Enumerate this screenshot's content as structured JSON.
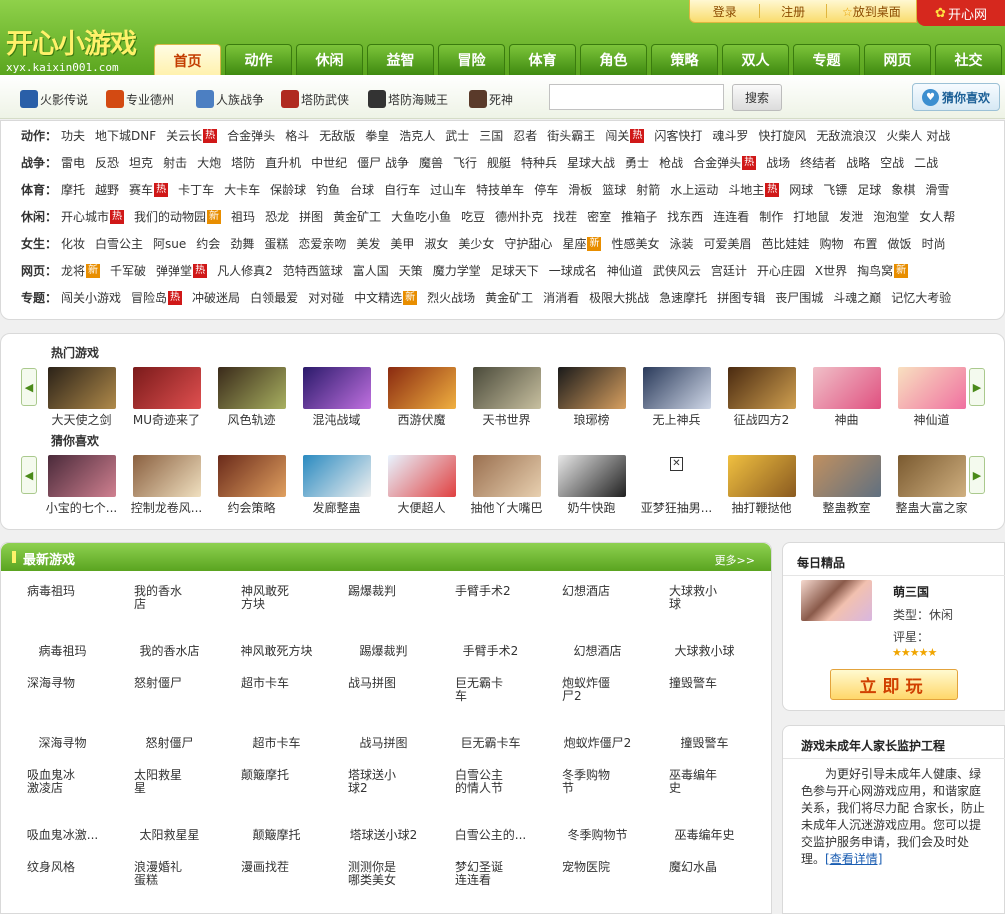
{
  "logo": {
    "title": "开心小游戏",
    "url": "xyx.kaixin001.com"
  },
  "toplinks": {
    "login": "登录",
    "register": "注册",
    "desktop": "放到桌面",
    "brand": "开心网"
  },
  "nav": [
    "首页",
    "动作",
    "休闲",
    "益智",
    "冒险",
    "体育",
    "角色",
    "策略",
    "双人",
    "专题",
    "网页",
    "社交"
  ],
  "quick": [
    {
      "label": "火影传说",
      "color": "#2a5fa8"
    },
    {
      "label": "专业德州",
      "color": "#d34a12"
    },
    {
      "label": "人族战争",
      "color": "#4c7fc2"
    },
    {
      "label": "塔防武侠",
      "color": "#b02a20"
    },
    {
      "label": "塔防海贼王",
      "color": "#333333"
    },
    {
      "label": "死神",
      "color": "#5a3a2a"
    }
  ],
  "search": {
    "button": "搜索",
    "placeholder": ""
  },
  "guess_button": "猜你喜欢",
  "categories": [
    {
      "label": "动作：",
      "items": [
        {
          "t": "功夫"
        },
        {
          "t": "地下城DNF"
        },
        {
          "t": "关云长",
          "tag": "热"
        },
        {
          "t": "合金弹头"
        },
        {
          "t": "格斗"
        },
        {
          "t": "无敌版"
        },
        {
          "t": "拳皇"
        },
        {
          "t": "浩克人"
        },
        {
          "t": "武士"
        },
        {
          "t": "三国"
        },
        {
          "t": "忍者"
        },
        {
          "t": "街头霸王"
        },
        {
          "t": "闯关",
          "tag": "热"
        },
        {
          "t": "闪客快打"
        },
        {
          "t": "魂斗罗"
        },
        {
          "t": "快打旋风"
        },
        {
          "t": "无敌流浪汉"
        },
        {
          "t": "火柴人 对战"
        }
      ]
    },
    {
      "label": "战争：",
      "items": [
        {
          "t": "雷电"
        },
        {
          "t": "反恐"
        },
        {
          "t": "坦克"
        },
        {
          "t": "射击"
        },
        {
          "t": "大炮"
        },
        {
          "t": "塔防"
        },
        {
          "t": "直升机"
        },
        {
          "t": "中世纪"
        },
        {
          "t": "僵尸 战争"
        },
        {
          "t": "魔兽"
        },
        {
          "t": "飞行"
        },
        {
          "t": "舰艇"
        },
        {
          "t": "特种兵"
        },
        {
          "t": "星球大战"
        },
        {
          "t": "勇士"
        },
        {
          "t": "枪战"
        },
        {
          "t": "合金弹头",
          "tag": "热"
        },
        {
          "t": "战场"
        },
        {
          "t": "终结者"
        },
        {
          "t": "战略"
        },
        {
          "t": "空战"
        },
        {
          "t": "二战"
        }
      ]
    },
    {
      "label": "体育：",
      "items": [
        {
          "t": "摩托"
        },
        {
          "t": "越野"
        },
        {
          "t": "赛车",
          "tag": "热"
        },
        {
          "t": "卡丁车"
        },
        {
          "t": "大卡车"
        },
        {
          "t": "保龄球"
        },
        {
          "t": "钓鱼"
        },
        {
          "t": "台球"
        },
        {
          "t": "自行车"
        },
        {
          "t": "过山车"
        },
        {
          "t": "特技单车"
        },
        {
          "t": "停车"
        },
        {
          "t": "滑板"
        },
        {
          "t": "篮球"
        },
        {
          "t": "射箭"
        },
        {
          "t": "水上运动"
        },
        {
          "t": "斗地主",
          "tag": "热"
        },
        {
          "t": "网球"
        },
        {
          "t": "飞镖"
        },
        {
          "t": "足球"
        },
        {
          "t": "象棋"
        },
        {
          "t": "滑雪"
        }
      ]
    },
    {
      "label": "休闲：",
      "items": [
        {
          "t": "开心城市",
          "tag": "热"
        },
        {
          "t": "我们的动物园",
          "tag": "新"
        },
        {
          "t": "祖玛"
        },
        {
          "t": "恐龙"
        },
        {
          "t": "拼图"
        },
        {
          "t": "黄金矿工"
        },
        {
          "t": "大鱼吃小鱼"
        },
        {
          "t": "吃豆"
        },
        {
          "t": "德州扑克"
        },
        {
          "t": "找茬"
        },
        {
          "t": "密室"
        },
        {
          "t": "推箱子"
        },
        {
          "t": "找东西"
        },
        {
          "t": "连连看"
        },
        {
          "t": "制作"
        },
        {
          "t": "打地鼠"
        },
        {
          "t": "发泄"
        },
        {
          "t": "泡泡堂"
        },
        {
          "t": "女人帮"
        }
      ]
    },
    {
      "label": "女生：",
      "items": [
        {
          "t": "化妆"
        },
        {
          "t": "白雪公主"
        },
        {
          "t": "阿sue"
        },
        {
          "t": "约会"
        },
        {
          "t": "劲舞"
        },
        {
          "t": "蛋糕"
        },
        {
          "t": "恋爱亲吻"
        },
        {
          "t": "美发"
        },
        {
          "t": "美甲"
        },
        {
          "t": "淑女"
        },
        {
          "t": "美少女"
        },
        {
          "t": "守护甜心"
        },
        {
          "t": "星座",
          "tag": "新"
        },
        {
          "t": "性感美女"
        },
        {
          "t": "泳装"
        },
        {
          "t": "可爱美眉"
        },
        {
          "t": "芭比娃娃"
        },
        {
          "t": "购物"
        },
        {
          "t": "布置"
        },
        {
          "t": "做饭"
        },
        {
          "t": "时尚"
        }
      ]
    },
    {
      "label": "网页：",
      "items": [
        {
          "t": "龙将",
          "tag": "新"
        },
        {
          "t": "千军破"
        },
        {
          "t": "弹弹堂",
          "tag": "热"
        },
        {
          "t": "凡人修真2"
        },
        {
          "t": "范特西篮球"
        },
        {
          "t": "富人国"
        },
        {
          "t": "天策"
        },
        {
          "t": "魔力学堂"
        },
        {
          "t": "足球天下"
        },
        {
          "t": "一球成名"
        },
        {
          "t": "神仙道"
        },
        {
          "t": "武侠风云"
        },
        {
          "t": "宫廷计"
        },
        {
          "t": "开心庄园"
        },
        {
          "t": "X世界"
        },
        {
          "t": "掏鸟窝",
          "tag": "新"
        }
      ]
    },
    {
      "label": "专题：",
      "items": [
        {
          "t": "闯关小游戏"
        },
        {
          "t": "冒险岛",
          "tag": "热"
        },
        {
          "t": "冲破迷局"
        },
        {
          "t": "白领最爱"
        },
        {
          "t": "对对碰"
        },
        {
          "t": "中文精选",
          "tag": "新"
        },
        {
          "t": "烈火战场"
        },
        {
          "t": "黄金矿工"
        },
        {
          "t": "消消看"
        },
        {
          "t": "极限大挑战"
        },
        {
          "t": "急速摩托"
        },
        {
          "t": "拼图专辑"
        },
        {
          "t": "丧尸围城"
        },
        {
          "t": "斗魂之巅"
        },
        {
          "t": "记忆大考验"
        }
      ]
    }
  ],
  "hot": {
    "title": "热门游戏",
    "games": [
      {
        "name": "大天使之剑",
        "c1": "#2b2218",
        "c2": "#b08a4a"
      },
      {
        "name": "MU奇迹来了",
        "c1": "#7a1a1a",
        "c2": "#e05050"
      },
      {
        "name": "风色轨迹",
        "c1": "#3a2a1a",
        "c2": "#a8b060"
      },
      {
        "name": "混沌战域",
        "c1": "#2a1a6a",
        "c2": "#c070e0"
      },
      {
        "name": "西游伏魔",
        "c1": "#8a2a10",
        "c2": "#f0b040"
      },
      {
        "name": "天书世界",
        "c1": "#4a4a3a",
        "c2": "#c8c0a0"
      },
      {
        "name": "琅琊榜",
        "c1": "#1a1a1a",
        "c2": "#d8a060"
      },
      {
        "name": "无上神兵",
        "c1": "#2a3a5a",
        "c2": "#d0d8e8"
      },
      {
        "name": "征战四方2",
        "c1": "#4a2a10",
        "c2": "#d0a050"
      },
      {
        "name": "神曲",
        "c1": "#f0c0c8",
        "c2": "#e05080"
      },
      {
        "name": "神仙道",
        "c1": "#f8e0c0",
        "c2": "#f070a0"
      }
    ]
  },
  "guess": {
    "title": "猜你喜欢",
    "games": [
      {
        "name": "小宝的七个...",
        "c1": "#4a2a3a",
        "c2": "#d08090"
      },
      {
        "name": "控制龙卷风...",
        "c1": "#8a6040",
        "c2": "#f0e0c0"
      },
      {
        "name": "约会策略",
        "c1": "#6a2a1a",
        "c2": "#e0a060"
      },
      {
        "name": "发廊整蛊",
        "c1": "#2a8ac0",
        "c2": "#f0f0f0"
      },
      {
        "name": "大便超人",
        "c1": "#e8f4ff",
        "c2": "#e04040"
      },
      {
        "name": "抽他丫大嘴巴",
        "c1": "#9a7050",
        "c2": "#e8d0b0"
      },
      {
        "name": "奶牛快跑",
        "c1": "#e8e8e8",
        "c2": "#202020"
      },
      {
        "name": "亚梦狂抽男...",
        "c1": "#ffffff",
        "c2": "#ffffff"
      },
      {
        "name": "抽打鞭挞他",
        "c1": "#f0c040",
        "c2": "#8a5a20"
      },
      {
        "name": "整蛊教室",
        "c1": "#c09060",
        "c2": "#607080"
      },
      {
        "name": "整蛊大富之家",
        "c1": "#7a5a30",
        "c2": "#d0b080"
      }
    ]
  },
  "new_games": {
    "title": "最新游戏",
    "more": "更多>>",
    "rows": [
      {
        "type": "top",
        "items": [
          "病毒祖玛",
          "我的香水店",
          "神风敢死方块",
          "踢爆裁判",
          "手臂手术2",
          "幻想酒店",
          "大球救小球"
        ]
      },
      {
        "type": "mid",
        "items": [
          "病毒祖玛",
          "我的香水店",
          "神风敢死方块",
          "踢爆裁判",
          "手臂手术2",
          "幻想酒店",
          "大球救小球"
        ]
      },
      {
        "type": "top",
        "items": [
          "深海寻物",
          "怒射僵尸",
          "超市卡车",
          "战马拼图",
          "巨无霸卡车",
          "炮蚁炸僵尸2",
          "撞毁警车"
        ]
      },
      {
        "type": "mid",
        "items": [
          "深海寻物",
          "怒射僵尸",
          "超市卡车",
          "战马拼图",
          "巨无霸卡车",
          "炮蚁炸僵尸2",
          "撞毁警车"
        ]
      },
      {
        "type": "top",
        "items": [
          "吸血鬼冰激凌店",
          "太阳救星星",
          "颠簸摩托",
          "塔球送小球2",
          "白雪公主的情人节",
          "冬季购物节",
          "巫毒编年史"
        ]
      },
      {
        "type": "mid",
        "items": [
          "吸血鬼冰激...",
          "太阳救星星",
          "颠簸摩托",
          "塔球送小球2",
          "白雪公主的...",
          "冬季购物节",
          "巫毒编年史"
        ]
      },
      {
        "type": "top",
        "items": [
          "纹身风格",
          "浪漫婚礼蛋糕",
          "漫画找茬",
          "测测你是哪类美女",
          "梦幻圣诞连连看",
          "宠物医院",
          "魔幻水晶"
        ]
      }
    ]
  },
  "daily": {
    "title": "每日精品",
    "game": "萌三国",
    "type": "类型：休闲",
    "rating_label": "评星：",
    "rating": 5,
    "stars": "★★★★★",
    "play": "立即玩"
  },
  "guard": {
    "title": "游戏未成年人家长监护工程",
    "text": "为更好引导未成年人健康、绿色参与开心网游戏应用，和谐家庭关系，我们将尽力配 合家长，防止未成年人沉迷游戏应用。您可以提交监护服务申请，我们会及时处理。",
    "link": "[查看详情]"
  }
}
